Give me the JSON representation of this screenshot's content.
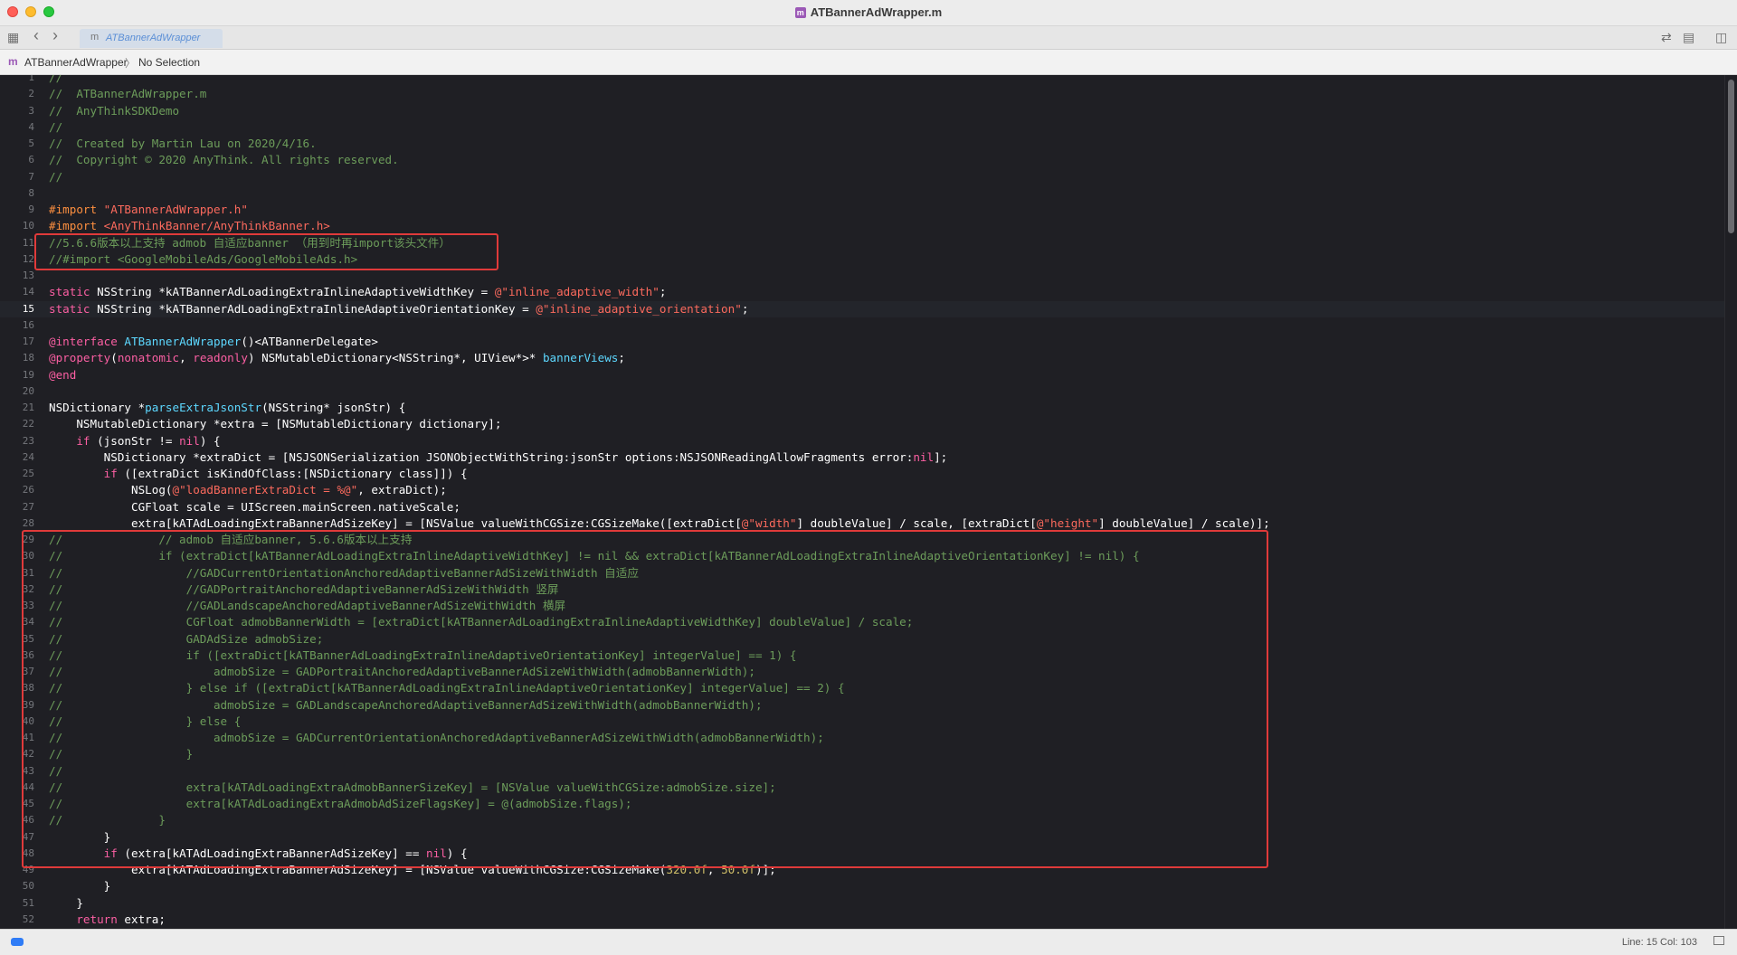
{
  "window": {
    "title": "ATBannerAdWrapper.m",
    "file_badge": "m"
  },
  "tab": {
    "label": "ATBannerAdWrapper",
    "badge": "m"
  },
  "jumpbar": {
    "badge": "m",
    "file": "ATBannerAdWrapper",
    "separator": "〉",
    "selection": "No Selection"
  },
  "toolbar_icons": {
    "grid": "▦",
    "back": "‹",
    "forward": "›",
    "swap": "⇄",
    "inspector": "▤",
    "split": "◫"
  },
  "status": {
    "position": "Line: 15  Col: 103"
  },
  "colors": {
    "comment": "#6c9c5a",
    "keyword": "#fc5fa3",
    "preprocessor": "#fd8f3f",
    "string": "#fc6a5d",
    "number": "#d0bf69",
    "decl": "#5dd8ff",
    "type": "#ffffff",
    "highlight_box": "#e03a3a"
  },
  "current_line": 15,
  "code_lines": [
    {
      "n": "1",
      "t": [
        [
          "c",
          "//"
        ]
      ]
    },
    {
      "n": "2",
      "t": [
        [
          "c",
          "//  ATBannerAdWrapper.m"
        ]
      ]
    },
    {
      "n": "3",
      "t": [
        [
          "c",
          "//  AnyThinkSDKDemo"
        ]
      ]
    },
    {
      "n": "4",
      "t": [
        [
          "c",
          "//"
        ]
      ]
    },
    {
      "n": "5",
      "t": [
        [
          "c",
          "//  Created by Martin Lau on 2020/4/16."
        ]
      ]
    },
    {
      "n": "6",
      "t": [
        [
          "c",
          "//  Copyright © 2020 AnyThink. All rights reserved."
        ]
      ]
    },
    {
      "n": "7",
      "t": [
        [
          "c",
          "//"
        ]
      ]
    },
    {
      "n": "8",
      "t": []
    },
    {
      "n": "9",
      "t": [
        [
          "p",
          "#import "
        ],
        [
          "s",
          "\"ATBannerAdWrapper.h\""
        ]
      ]
    },
    {
      "n": "10",
      "t": [
        [
          "p",
          "#import "
        ],
        [
          "s",
          "<AnyThinkBanner/AnyThinkBanner.h>"
        ]
      ]
    },
    {
      "n": "11",
      "t": [
        [
          "c",
          "//5.6.6版本以上支持 admob 自适应banner （用到时再import该头文件）"
        ]
      ]
    },
    {
      "n": "12",
      "t": [
        [
          "c",
          "//#import <GoogleMobileAds/GoogleMobileAds.h>"
        ]
      ]
    },
    {
      "n": "13",
      "t": []
    },
    {
      "n": "14",
      "t": [
        [
          "k",
          "static"
        ],
        [
          "x",
          " NSString *kATBannerAdLoadingExtraInlineAdaptiveWidthKey = "
        ],
        [
          "s",
          "@\"inline_adaptive_width\""
        ],
        [
          "x",
          ";"
        ]
      ]
    },
    {
      "n": "15",
      "t": [
        [
          "k",
          "static"
        ],
        [
          "x",
          " NSString *kATBannerAdLoadingExtraInlineAdaptiveOrientationKey = "
        ],
        [
          "s",
          "@\"inline_adaptive_orientation\""
        ],
        [
          "x",
          ";"
        ]
      ]
    },
    {
      "n": "16",
      "t": []
    },
    {
      "n": "17",
      "t": [
        [
          "k",
          "@interface"
        ],
        [
          "x",
          " "
        ],
        [
          "d",
          "ATBannerAdWrapper"
        ],
        [
          "x",
          "()<ATBannerDelegate>"
        ]
      ]
    },
    {
      "n": "18",
      "t": [
        [
          "k",
          "@property"
        ],
        [
          "x",
          "("
        ],
        [
          "k",
          "nonatomic"
        ],
        [
          "x",
          ", "
        ],
        [
          "k",
          "readonly"
        ],
        [
          "x",
          ") NSMutableDictionary<NSString*, UIView*>* "
        ],
        [
          "d",
          "bannerViews"
        ],
        [
          "x",
          ";"
        ]
      ]
    },
    {
      "n": "19",
      "t": [
        [
          "k",
          "@end"
        ]
      ]
    },
    {
      "n": "20",
      "t": []
    },
    {
      "n": "21",
      "t": [
        [
          "x",
          "NSDictionary *"
        ],
        [
          "d",
          "parseExtraJsonStr"
        ],
        [
          "x",
          "(NSString* jsonStr) {"
        ]
      ]
    },
    {
      "n": "22",
      "t": [
        [
          "x",
          "    NSMutableDictionary *extra = [NSMutableDictionary dictionary];"
        ]
      ]
    },
    {
      "n": "23",
      "t": [
        [
          "x",
          "    "
        ],
        [
          "k",
          "if"
        ],
        [
          "x",
          " (jsonStr != "
        ],
        [
          "k",
          "nil"
        ],
        [
          "x",
          ") {"
        ]
      ]
    },
    {
      "n": "24",
      "t": [
        [
          "x",
          "        NSDictionary *extraDict = [NSJSONSerialization JSONObjectWithString:jsonStr options:NSJSONReadingAllowFragments error:"
        ],
        [
          "k",
          "nil"
        ],
        [
          "x",
          "];"
        ]
      ]
    },
    {
      "n": "25",
      "t": [
        [
          "x",
          "        "
        ],
        [
          "k",
          "if"
        ],
        [
          "x",
          " ([extraDict isKindOfClass:[NSDictionary class]]) {"
        ]
      ]
    },
    {
      "n": "26",
      "t": [
        [
          "x",
          "            NSLog("
        ],
        [
          "s",
          "@\"loadBannerExtraDict = %@\""
        ],
        [
          "x",
          ", extraDict);"
        ]
      ]
    },
    {
      "n": "27",
      "t": [
        [
          "x",
          "            CGFloat scale = UIScreen.mainScreen.nativeScale;"
        ]
      ]
    },
    {
      "n": "28",
      "t": [
        [
          "x",
          "            extra[kATAdLoadingExtraBannerAdSizeKey] = [NSValue valueWithCGSize:CGSizeMake([extraDict["
        ],
        [
          "s",
          "@\"width\""
        ],
        [
          "x",
          "] doubleValue] / scale, [extraDict["
        ],
        [
          "s",
          "@\"height\""
        ],
        [
          "x",
          "] doubleValue] / scale)];"
        ]
      ]
    },
    {
      "n": "29",
      "t": [
        [
          "c",
          "//              // admob 自适应banner, 5.6.6版本以上支持"
        ]
      ]
    },
    {
      "n": "30",
      "t": [
        [
          "c",
          "//              if (extraDict[kATBannerAdLoadingExtraInlineAdaptiveWidthKey] != nil && extraDict[kATBannerAdLoadingExtraInlineAdaptiveOrientationKey] != nil) {"
        ]
      ]
    },
    {
      "n": "31",
      "t": [
        [
          "c",
          "//                  //GADCurrentOrientationAnchoredAdaptiveBannerAdSizeWithWidth 自适应"
        ]
      ]
    },
    {
      "n": "32",
      "t": [
        [
          "c",
          "//                  //GADPortraitAnchoredAdaptiveBannerAdSizeWithWidth 竖屏"
        ]
      ]
    },
    {
      "n": "33",
      "t": [
        [
          "c",
          "//                  //GADLandscapeAnchoredAdaptiveBannerAdSizeWithWidth 横屏"
        ]
      ]
    },
    {
      "n": "34",
      "t": [
        [
          "c",
          "//                  CGFloat admobBannerWidth = [extraDict[kATBannerAdLoadingExtraInlineAdaptiveWidthKey] doubleValue] / scale;"
        ]
      ]
    },
    {
      "n": "35",
      "t": [
        [
          "c",
          "//                  GADAdSize admobSize;"
        ]
      ]
    },
    {
      "n": "36",
      "t": [
        [
          "c",
          "//                  if ([extraDict[kATBannerAdLoadingExtraInlineAdaptiveOrientationKey] integerValue] == 1) {"
        ]
      ]
    },
    {
      "n": "37",
      "t": [
        [
          "c",
          "//                      admobSize = GADPortraitAnchoredAdaptiveBannerAdSizeWithWidth(admobBannerWidth);"
        ]
      ]
    },
    {
      "n": "38",
      "t": [
        [
          "c",
          "//                  } else if ([extraDict[kATBannerAdLoadingExtraInlineAdaptiveOrientationKey] integerValue] == 2) {"
        ]
      ]
    },
    {
      "n": "39",
      "t": [
        [
          "c",
          "//                      admobSize = GADLandscapeAnchoredAdaptiveBannerAdSizeWithWidth(admobBannerWidth);"
        ]
      ]
    },
    {
      "n": "40",
      "t": [
        [
          "c",
          "//                  } else {"
        ]
      ]
    },
    {
      "n": "41",
      "t": [
        [
          "c",
          "//                      admobSize = GADCurrentOrientationAnchoredAdaptiveBannerAdSizeWithWidth(admobBannerWidth);"
        ]
      ]
    },
    {
      "n": "42",
      "t": [
        [
          "c",
          "//                  }"
        ]
      ]
    },
    {
      "n": "43",
      "t": [
        [
          "c",
          "//"
        ]
      ]
    },
    {
      "n": "44",
      "t": [
        [
          "c",
          "//                  extra[kATAdLoadingExtraAdmobBannerSizeKey] = [NSValue valueWithCGSize:admobSize.size];"
        ]
      ]
    },
    {
      "n": "45",
      "t": [
        [
          "c",
          "//                  extra[kATAdLoadingExtraAdmobAdSizeFlagsKey] = @(admobSize.flags);"
        ]
      ]
    },
    {
      "n": "46",
      "t": [
        [
          "c",
          "//              }"
        ]
      ]
    },
    {
      "n": "47",
      "t": [
        [
          "x",
          "        }"
        ]
      ]
    },
    {
      "n": "48",
      "t": [
        [
          "x",
          "        "
        ],
        [
          "k",
          "if"
        ],
        [
          "x",
          " (extra[kATAdLoadingExtraBannerAdSizeKey] == "
        ],
        [
          "k",
          "nil"
        ],
        [
          "x",
          ") {"
        ]
      ]
    },
    {
      "n": "49",
      "t": [
        [
          "x",
          "            extra[kATAdLoadingExtraBannerAdSizeKey] = [NSValue valueWithCGSize:CGSizeMake("
        ],
        [
          "u",
          "320.0f"
        ],
        [
          "x",
          ", "
        ],
        [
          "u",
          "50.0f"
        ],
        [
          "x",
          ")];"
        ]
      ]
    },
    {
      "n": "50",
      "t": [
        [
          "x",
          "        }"
        ]
      ]
    },
    {
      "n": "51",
      "t": [
        [
          "x",
          "    }"
        ]
      ]
    },
    {
      "n": "52",
      "t": [
        [
          "x",
          "    "
        ],
        [
          "k",
          "return"
        ],
        [
          "x",
          " extra;"
        ]
      ]
    }
  ]
}
